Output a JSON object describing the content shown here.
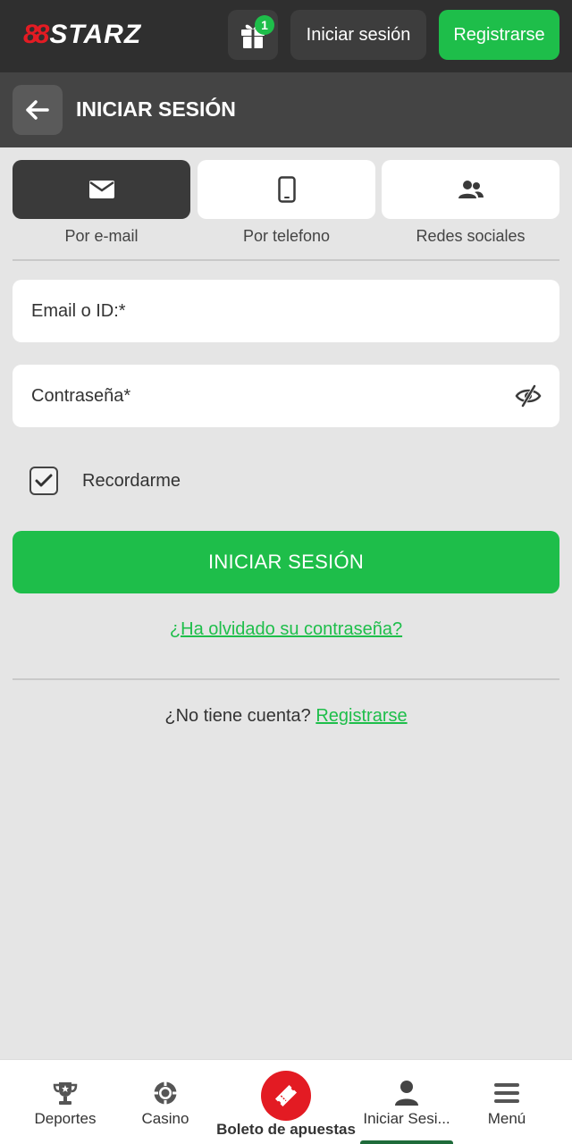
{
  "header": {
    "logo_mark": "88",
    "logo_text": "STARZ",
    "gift_badge": "1",
    "login_label": "Iniciar sesión",
    "register_label": "Registrarse"
  },
  "titlebar": {
    "title": "INICIAR SESIÓN"
  },
  "tabs": [
    {
      "label": "Por e-mail",
      "icon": "envelope-icon",
      "active": true
    },
    {
      "label": "Por telefono",
      "icon": "smartphone-icon",
      "active": false
    },
    {
      "label": "Redes sociales",
      "icon": "users-icon",
      "active": false
    }
  ],
  "form": {
    "email_placeholder": "Email o ID:*",
    "password_placeholder": "Contraseña*",
    "remember_label": "Recordarme",
    "remember_checked": true,
    "submit_label": "INICIAR SESIÓN",
    "forgot_label": "¿Ha olvidado su contraseña?",
    "no_account_text": "¿No tiene cuenta?",
    "register_link": "Registrarse"
  },
  "bottom_nav": {
    "items": [
      {
        "label": "Deportes",
        "icon": "trophy-icon"
      },
      {
        "label": "Casino",
        "icon": "casino-chip-icon"
      },
      {
        "label": "Boleto de apuestas",
        "icon": "ticket-icon"
      },
      {
        "label": "Iniciar Sesi...",
        "icon": "user-icon"
      },
      {
        "label": "Menú",
        "icon": "menu-icon"
      }
    ],
    "active_index": 3
  },
  "colors": {
    "accent_green": "#1ebe4a",
    "brand_red": "#e31b23",
    "header_dark": "#2f2f2f",
    "titlebar": "#444444",
    "background": "#e5e5e5"
  }
}
